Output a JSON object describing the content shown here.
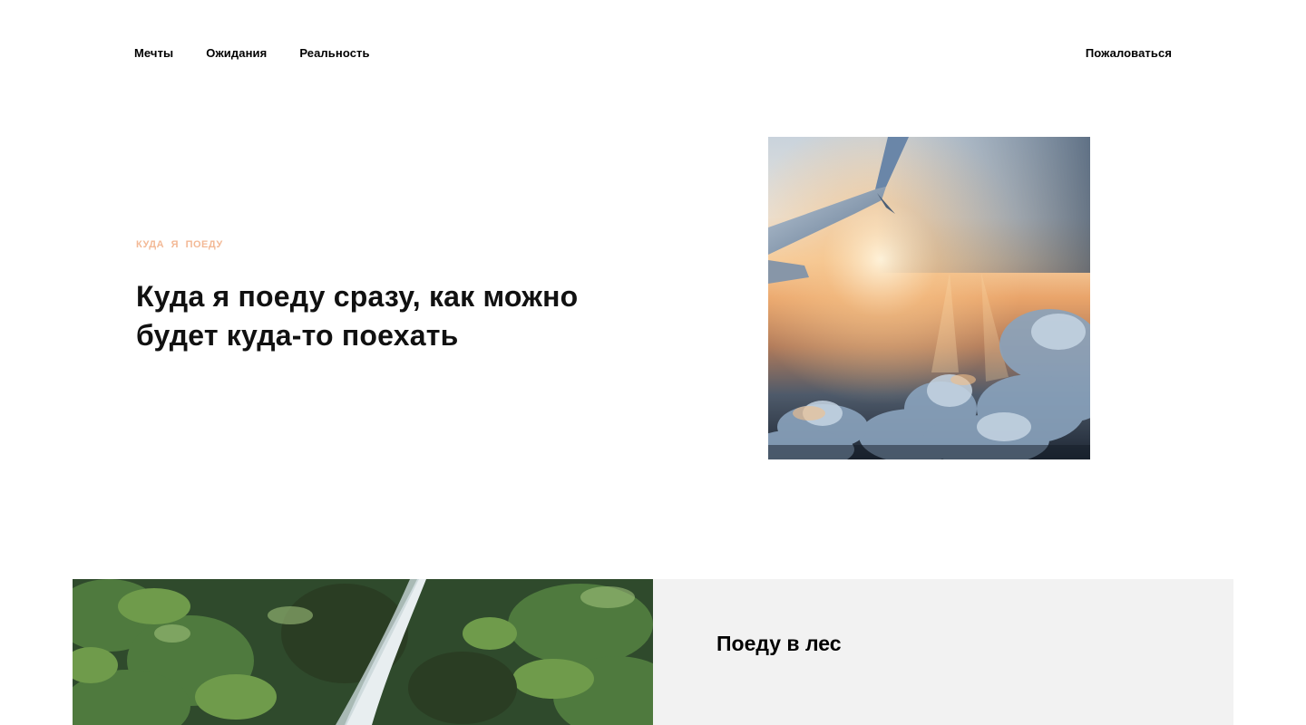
{
  "nav": {
    "items": [
      {
        "label": "Мечты"
      },
      {
        "label": "Ожидания"
      },
      {
        "label": "Реальность"
      }
    ],
    "complain_label": "Пожаловаться"
  },
  "hero": {
    "eyebrow": "КУДА Я ПОЕДУ",
    "title": "Куда я поеду сразу, как можно будет куда-то поехать",
    "eyebrow_color": "#f3b996"
  },
  "section2": {
    "title": "Поеду в лес",
    "card_background": "#f2f2f2"
  }
}
